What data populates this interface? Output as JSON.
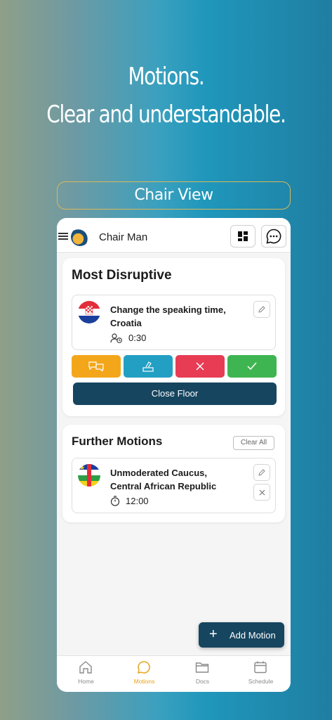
{
  "headline": {
    "line1": "Motions.",
    "line2": "Clear and understandable."
  },
  "pill": {
    "label": "Chair View"
  },
  "topbar": {
    "user_name": "Chair Man",
    "icons": [
      "menu-icon",
      "logo",
      "dashboard-icon",
      "chat-icon"
    ]
  },
  "most_disruptive": {
    "title": "Most Disruptive",
    "motion": {
      "title": "Change the speaking time, Croatia",
      "time": "0:30",
      "country": "Croatia"
    },
    "actions": [
      {
        "name": "discuss",
        "color": "#f4a61b"
      },
      {
        "name": "vote",
        "color": "#239fc4"
      },
      {
        "name": "reject",
        "color": "#e83c54"
      },
      {
        "name": "approve",
        "color": "#3fb551"
      }
    ],
    "close_floor_label": "Close Floor"
  },
  "further_motions": {
    "title": "Further Motions",
    "clear_all_label": "Clear All",
    "items": [
      {
        "title": "Unmoderated Caucus, Central African Republic",
        "time": "12:00",
        "country": "Central African Republic"
      }
    ]
  },
  "fab": {
    "label": "Add Motion"
  },
  "tabs": [
    {
      "label": "Home",
      "active": false
    },
    {
      "label": "Motions",
      "active": true
    },
    {
      "label": "Docs",
      "active": false
    },
    {
      "label": "Schedule",
      "active": false
    }
  ],
  "colors": {
    "primary": "#16455f",
    "accent": "#e8a21a"
  }
}
